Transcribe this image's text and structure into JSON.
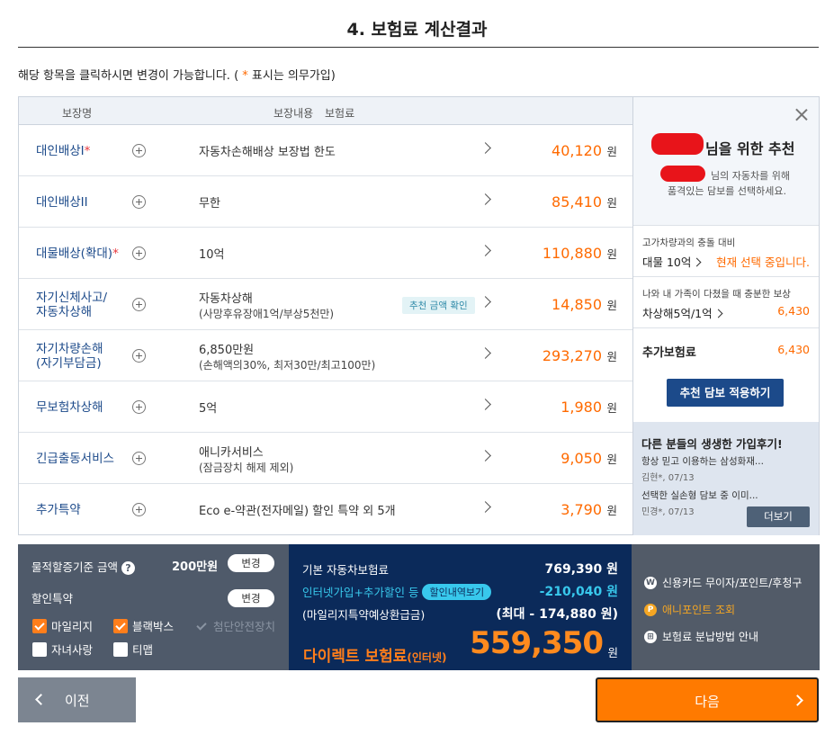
{
  "page": {
    "title": "4. 보험료 계산결과",
    "instruction_pre": "해당 항목을 클릭하시면 변경이 가능합니다. ( ",
    "instruction_star": "*",
    "instruction_post": " 표시는 의무가입)"
  },
  "table": {
    "headers": {
      "coverage": "보장명",
      "content": "보장내용",
      "premium": "보험료"
    },
    "currency": "원",
    "rows": [
      {
        "name": "대인배상I",
        "required": true,
        "desc": "자동차손해배상 보장법 한도",
        "sub": "",
        "tag": "",
        "price": "40,120"
      },
      {
        "name": "대인배상II",
        "required": false,
        "desc": "무한",
        "sub": "",
        "tag": "",
        "price": "85,410"
      },
      {
        "name": "대물배상(확대)",
        "required": true,
        "desc": "10억",
        "sub": "",
        "tag": "",
        "price": "110,880"
      },
      {
        "name": "자기신체사고/",
        "name2": "자동차상해",
        "required": false,
        "desc": "자동차상해",
        "sub": "(사망후유장애1억/부상5천만)",
        "tag": "추천 금액 확인",
        "price": "14,850"
      },
      {
        "name": "자기차량손해",
        "name2": "(자기부담금)",
        "required": false,
        "desc": "6,850만원",
        "sub": "(손해액의30%, 최저30만/최고100만)",
        "tag": "",
        "price": "293,270"
      },
      {
        "name": "무보험차상해",
        "required": false,
        "desc": "5억",
        "sub": "",
        "tag": "",
        "price": "1,980"
      },
      {
        "name": "긴급출동서비스",
        "required": false,
        "desc": "애니카서비스",
        "sub": "(잠금장치 해제 제외)",
        "tag": "",
        "price": "9,050"
      },
      {
        "name": "추가특약",
        "required": false,
        "desc": "Eco e-약관(전자메일) 할인 특약 외 5개",
        "sub": "",
        "tag": "",
        "price": "3,790"
      }
    ]
  },
  "recommend": {
    "title_suffix": "님을 위한 추천",
    "msg1": "님의 자동차를 위해",
    "msg2": "품격있는 담보를 선택하세요.",
    "options": [
      {
        "caption": "고가차량과의 충돌 대비",
        "value": "대물 10억",
        "right": "현재 선택 중입니다."
      },
      {
        "caption": "나와 내 가족이 다쳤을 때 충분한 보상",
        "value": "차상해5억/1억",
        "right": "6,430"
      }
    ],
    "extra_label": "추가보험료",
    "extra_value": "6,430",
    "apply_button": "추천 담보 적용하기",
    "reviews_title": "다른 분들의 생생한 가입후기!",
    "reviews": [
      {
        "text": "항상 믿고 이용하는 삼성화재...",
        "meta": "김현*, 07/13"
      },
      {
        "text": "선택한 실손형 담보 중 이미...",
        "meta": "민경*, 07/13"
      }
    ],
    "more_button": "더보기"
  },
  "summary_left": {
    "vehicle_label": "물적할증기준 금액",
    "help": "?",
    "vehicle_value": "200만원",
    "change_button": "변경",
    "discount_label": "할인특약",
    "change_button2": "변경",
    "checks": [
      {
        "label": "마일리지",
        "state": "on"
      },
      {
        "label": "블랙박스",
        "state": "on"
      },
      {
        "label": "첨단안전장치",
        "state": "disabled"
      },
      {
        "label": "자녀사랑",
        "state": "off"
      },
      {
        "label": "티맵",
        "state": "off"
      }
    ]
  },
  "summary_mid": {
    "base_label": "기본 자동차보험료",
    "base_value": "769,390 원",
    "discount_label": "인터넷가입+추가할인 등",
    "discount_pill": "할인내역보기",
    "discount_value": "-210,040 원",
    "mileage_label": "(마일리지특약예상환급금)",
    "mileage_value": "(최대 - 174,880 원)",
    "final_label": "다이렉트 보험료",
    "final_sub": "(인터넷)",
    "final_value": "559,350",
    "final_unit": "원"
  },
  "summary_right": {
    "items": [
      {
        "icon": "W",
        "label": "신용카드 무이자/포인트/후청구"
      },
      {
        "icon": "P",
        "label": "애니포인트 조회"
      },
      {
        "icon": "⊞",
        "label": "보험료 분납방법 안내"
      }
    ]
  },
  "nav": {
    "prev": "이전",
    "next": "다음"
  },
  "colors": {
    "accent": "#ff7a00",
    "navy": "#0b2a5a",
    "link": "#1c4a8a",
    "redaction": "#e8141a"
  }
}
